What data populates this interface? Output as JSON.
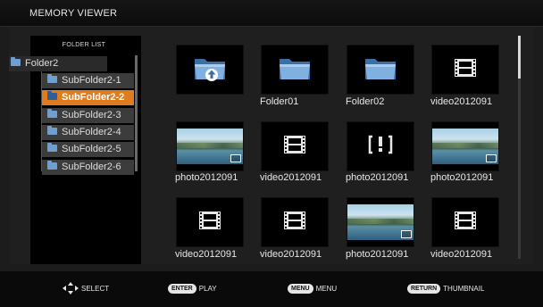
{
  "window": {
    "title": "MEMORY VIEWER"
  },
  "folder_list": {
    "title": "FOLDER LIST",
    "root": "Folder2",
    "items": [
      {
        "label": "SubFolder2-1",
        "selected": false
      },
      {
        "label": "SubFolder2-2",
        "selected": true
      },
      {
        "label": "SubFolder2-3",
        "selected": false
      },
      {
        "label": "SubFolder2-4",
        "selected": false
      },
      {
        "label": "SubFolder2-5",
        "selected": false
      },
      {
        "label": "SubFolder2-6",
        "selected": false
      }
    ]
  },
  "grid": [
    {
      "type": "up",
      "label": ""
    },
    {
      "type": "folder",
      "label": "Folder01"
    },
    {
      "type": "folder",
      "label": "Folder02"
    },
    {
      "type": "video",
      "label": "video2012091"
    },
    {
      "type": "photo",
      "label": "photo2012091"
    },
    {
      "type": "video",
      "label": "video2012091"
    },
    {
      "type": "error",
      "label": "photo2012091"
    },
    {
      "type": "photo",
      "label": "photo2012091"
    },
    {
      "type": "video",
      "label": "video2012091"
    },
    {
      "type": "video",
      "label": "video2012091"
    },
    {
      "type": "photo",
      "label": "photo2012091"
    },
    {
      "type": "video",
      "label": "video2012091"
    }
  ],
  "footer": {
    "select": "SELECT",
    "enter_key": "ENTER",
    "play": "PLAY",
    "menu_key": "MENU",
    "menu": "MENU",
    "return_key": "RETURN",
    "thumbnail": "THUMBNAIL"
  },
  "colors": {
    "selection": "#e07b1e",
    "folder_icon": "#6f9fd1",
    "background": "#1c1c1c"
  }
}
